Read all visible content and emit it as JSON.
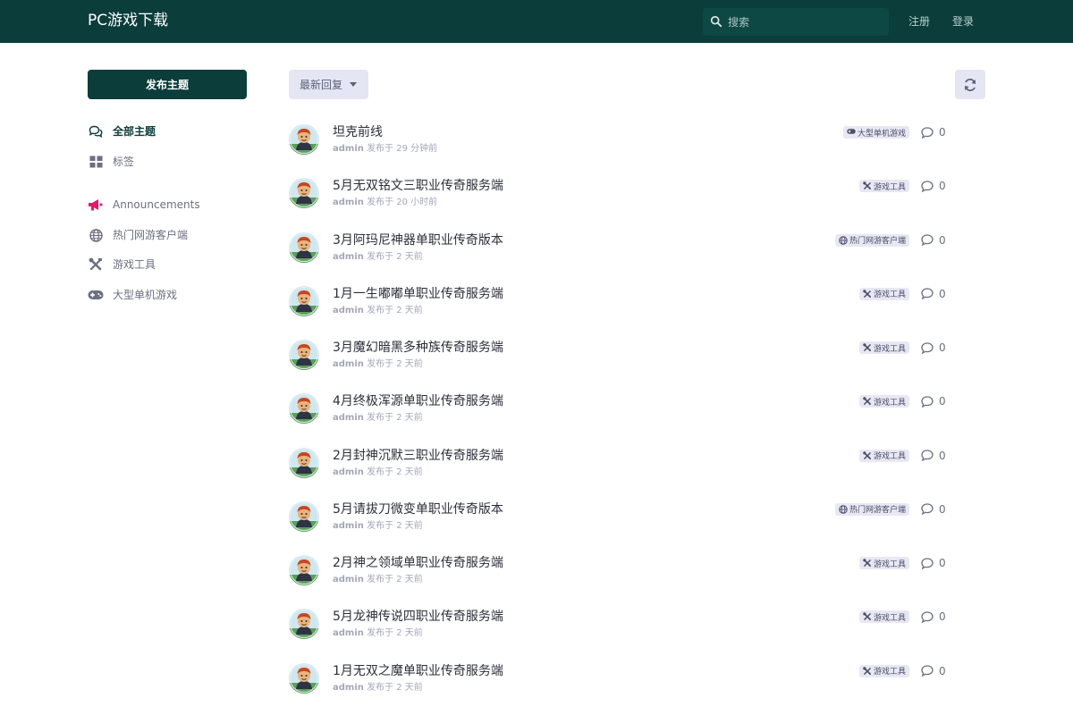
{
  "header": {
    "site_title": "PC游戏下载",
    "search_placeholder": "搜索",
    "register_label": "注册",
    "login_label": "登录"
  },
  "sidebar": {
    "new_topic_label": "发布主题",
    "items": [
      {
        "label": "全部主题",
        "icon": "comments-icon",
        "active": true
      },
      {
        "label": "标签",
        "icon": "grid-icon",
        "active": false
      },
      {
        "label": "Announcements",
        "icon": "megaphone-icon",
        "active": false,
        "color": "#e5196b"
      },
      {
        "label": "热门网游客户端",
        "icon": "globe-icon",
        "active": false
      },
      {
        "label": "游戏工具",
        "icon": "tools-icon",
        "active": false
      },
      {
        "label": "大型单机游戏",
        "icon": "gamepad-icon",
        "active": false
      }
    ]
  },
  "toolbar": {
    "sort_label": "最新回复",
    "refresh_icon": "refresh-icon"
  },
  "discussions": [
    {
      "title": "坦克前线",
      "author": "admin",
      "meta": "发布于 29 分钟前",
      "tag": "大型单机游戏",
      "tag_icon": "gamepad-icon",
      "replies": "0"
    },
    {
      "title": "5月无双铭文三职业传奇服务端",
      "author": "admin",
      "meta": "发布于 20 小时前",
      "tag": "游戏工具",
      "tag_icon": "tools-icon",
      "replies": "0"
    },
    {
      "title": "3月阿玛尼神器单职业传奇版本",
      "author": "admin",
      "meta": "发布于 2 天前",
      "tag": "热门网游客户端",
      "tag_icon": "globe-icon",
      "replies": "0"
    },
    {
      "title": "1月一生嘟嘟单职业传奇服务端",
      "author": "admin",
      "meta": "发布于 2 天前",
      "tag": "游戏工具",
      "tag_icon": "tools-icon",
      "replies": "0"
    },
    {
      "title": "3月魔幻暗黑多种族传奇服务端",
      "author": "admin",
      "meta": "发布于 2 天前",
      "tag": "游戏工具",
      "tag_icon": "tools-icon",
      "replies": "0"
    },
    {
      "title": "4月终极浑源单职业传奇服务端",
      "author": "admin",
      "meta": "发布于 2 天前",
      "tag": "游戏工具",
      "tag_icon": "tools-icon",
      "replies": "0"
    },
    {
      "title": "2月封神沉默三职业传奇服务端",
      "author": "admin",
      "meta": "发布于 2 天前",
      "tag": "游戏工具",
      "tag_icon": "tools-icon",
      "replies": "0"
    },
    {
      "title": "5月请拔刀微变单职业传奇版本",
      "author": "admin",
      "meta": "发布于 2 天前",
      "tag": "热门网游客户端",
      "tag_icon": "globe-icon",
      "replies": "0"
    },
    {
      "title": "2月神之领域单职业传奇服务端",
      "author": "admin",
      "meta": "发布于 2 天前",
      "tag": "游戏工具",
      "tag_icon": "tools-icon",
      "replies": "0"
    },
    {
      "title": "5月龙神传说四职业传奇服务端",
      "author": "admin",
      "meta": "发布于 2 天前",
      "tag": "游戏工具",
      "tag_icon": "tools-icon",
      "replies": "0"
    },
    {
      "title": "1月无双之魔单职业传奇服务端",
      "author": "admin",
      "meta": "发布于 2 天前",
      "tag": "游戏工具",
      "tag_icon": "tools-icon",
      "replies": "0"
    }
  ],
  "colors": {
    "header_bg": "#0b3d3a",
    "accent": "#0b3d3a",
    "tag_bg": "#e7e8f4",
    "announcement": "#e5196b"
  }
}
